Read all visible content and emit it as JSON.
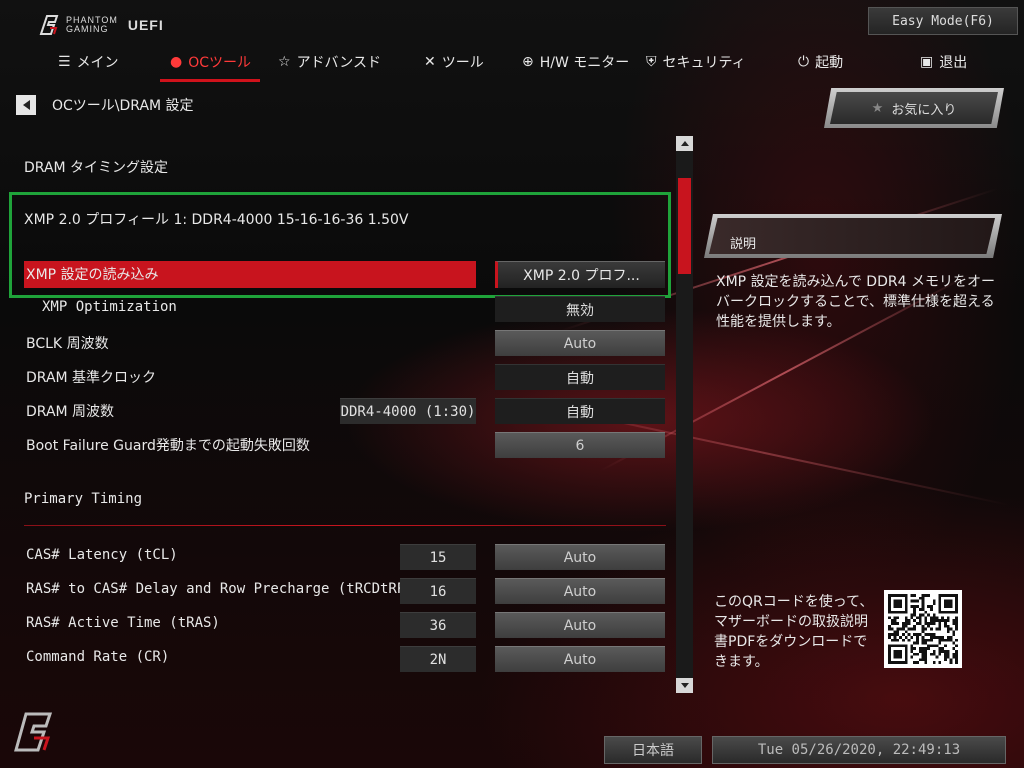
{
  "header": {
    "brand_line1": "PHANTOM",
    "brand_line2": "GAMING",
    "brand_uefi": "UEFI",
    "easy_mode_label": "Easy Mode(F6)"
  },
  "tabs": [
    {
      "label": "メイン",
      "icon": "list-icon"
    },
    {
      "label": "OCツール",
      "icon": "flame-icon",
      "active": true
    },
    {
      "label": "アドバンスド",
      "icon": "star-icon"
    },
    {
      "label": "ツール",
      "icon": "tools-icon"
    },
    {
      "label": "H/W モニター",
      "icon": "crosshair-icon"
    },
    {
      "label": "セキュリティ",
      "icon": "shield-icon"
    },
    {
      "label": "起動",
      "icon": "power-icon"
    },
    {
      "label": "退出",
      "icon": "exit-icon"
    }
  ],
  "breadcrumb": "OCツール\\DRAM 設定",
  "favorites_label": "お気に入り",
  "settings": {
    "section_dram_timing": "DRAM タイミング設定",
    "xmp_profile_info": "XMP 2.0 プロフィール 1: DDR4-4000 15-16-16-36 1.50V",
    "load_xmp": {
      "label": "XMP 設定の読み込み",
      "value": "XMP 2.0 プロフ..."
    },
    "xmp_optimization": {
      "label": "XMP Optimization",
      "value": "無効"
    },
    "bclk": {
      "label": "BCLK 周波数",
      "value": "Auto"
    },
    "dram_ref_clock": {
      "label": "DRAM 基準クロック",
      "value": "自動"
    },
    "dram_freq": {
      "label": "DRAM 周波数",
      "current": "DDR4-4000 (1:30)",
      "value": "自動"
    },
    "boot_failure": {
      "label": "Boot Failure Guard発動までの起動失敗回数",
      "value": "6"
    },
    "section_primary": "Primary Timing",
    "cas": {
      "label": "CAS# Latency (tCL)",
      "current": "15",
      "value": "Auto"
    },
    "rcd": {
      "label": "RAS# to CAS# Delay and Row Precharge (tRCDtRP)",
      "current": "16",
      "value": "Auto"
    },
    "ras": {
      "label": "RAS# Active Time (tRAS)",
      "current": "36",
      "value": "Auto"
    },
    "cr": {
      "label": "Command Rate (CR)",
      "current": "2N",
      "value": "Auto"
    }
  },
  "description": {
    "title": "説明",
    "text": "XMP 設定を読み込んで DDR4 メモリをオーバークロックすることで、標準仕様を超える性能を提供します。"
  },
  "qr": {
    "text": "このQRコードを使って、マザーボードの取扱説明書PDFをダウンロードできます。"
  },
  "footer": {
    "language": "日本語",
    "datetime": "Tue 05/26/2020, 22:49:13"
  },
  "colors": {
    "accent": "#c8141e",
    "active_tab": "#ff3a3a",
    "highlight_box": "#1fa33a"
  }
}
